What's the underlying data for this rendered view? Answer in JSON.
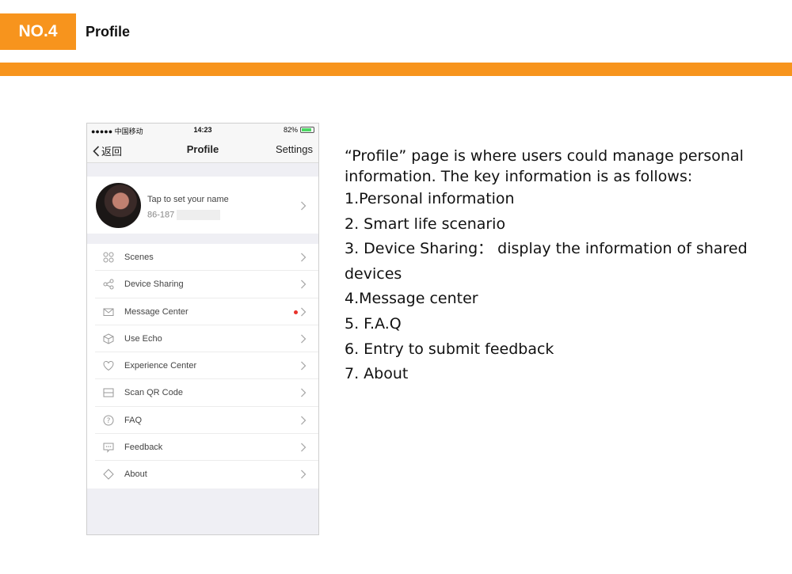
{
  "header": {
    "badge": "NO.4",
    "title": "Profile"
  },
  "phone": {
    "status_bar": {
      "carrier": "●●●●● 中国移动",
      "time": "14:23",
      "battery": "82%"
    },
    "nav": {
      "back_label": "返回",
      "title": "Profile",
      "settings_label": "Settings"
    },
    "profile": {
      "name_prompt": "Tap to set your name",
      "phone_prefix": "86-187"
    },
    "menu_items": [
      {
        "label": "Scenes",
        "icon": "scenes-icon"
      },
      {
        "label": "Device Sharing",
        "icon": "share-icon"
      },
      {
        "label": "Message Center",
        "icon": "mail-icon",
        "unread": true
      },
      {
        "label": "Use Echo",
        "icon": "cube-icon"
      },
      {
        "label": "Experience Center",
        "icon": "heart-icon"
      },
      {
        "label": "Scan QR Code",
        "icon": "scan-icon"
      },
      {
        "label": "FAQ",
        "icon": "question-icon"
      },
      {
        "label": "Feedback",
        "icon": "chat-icon"
      },
      {
        "label": "About",
        "icon": "diamond-icon"
      }
    ]
  },
  "description": {
    "intro": "“Profile” page is where users could manage personal information. The key information is as follows:",
    "items": [
      "1.Personal information",
      "2. Smart life scenario",
      "3. Device Sharing：  display the information of shared devices",
      "4.Message center",
      "5. F.A.Q",
      "6. Entry to submit feedback",
      "7. About"
    ]
  },
  "colors": {
    "accent": "#f7941d",
    "unread_dot": "#e8322b"
  }
}
